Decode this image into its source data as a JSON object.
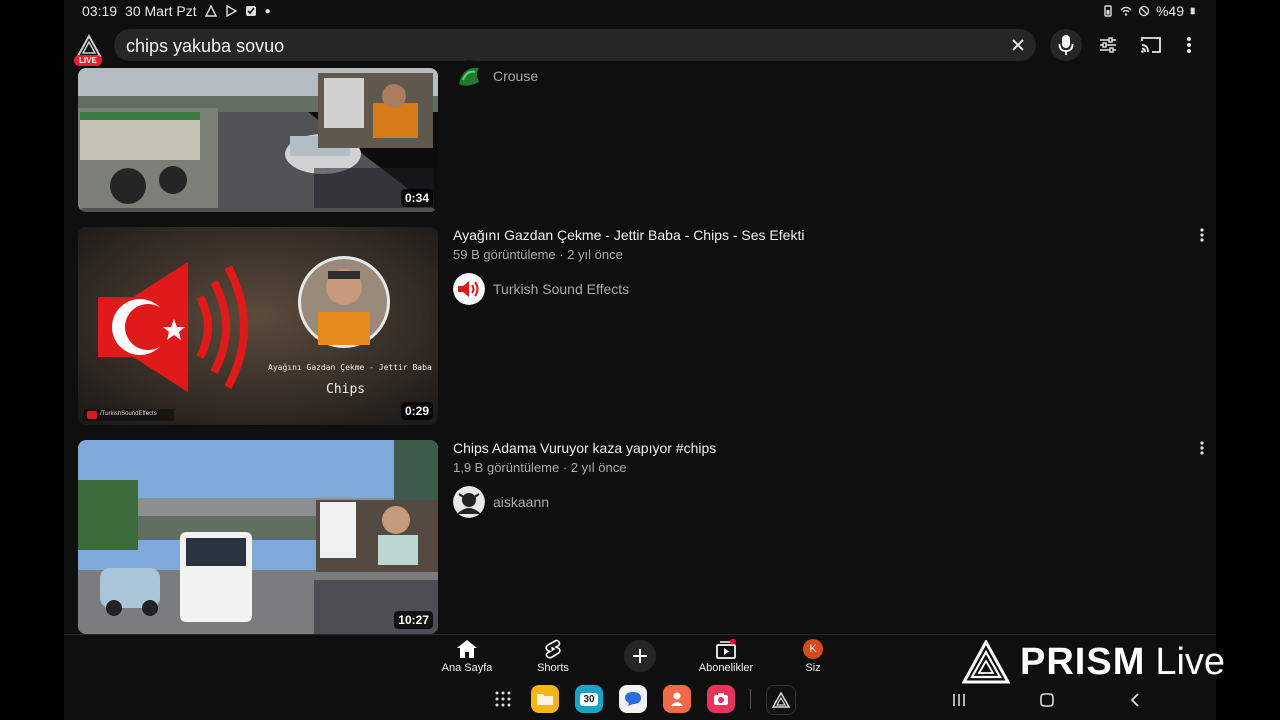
{
  "status_bar": {
    "time": "03:19",
    "date": "30 Mart Pzt",
    "battery": "%49"
  },
  "search": {
    "query": "chips yakuba sovuo",
    "live_badge": "LIVE"
  },
  "results": [
    {
      "duration": "0:34",
      "channel": "Crouse"
    },
    {
      "title": "Ayağını Gazdan Çekme - Jettir Baba - Chips - Ses Efekti",
      "meta": "59 B görüntüleme · 2 yıl önce",
      "channel": "Turkish Sound Effects",
      "duration": "0:29",
      "thumb_caption": "Ayağını Gazdan Çekme - Jettir Baba",
      "thumb_subcaption": "Chips",
      "thumb_watermark": "/TurkishSoundEffects"
    },
    {
      "title": "Chips Adama Vuruyor kaza yapıyor #chips",
      "meta": "1,9 B görüntüleme · 2 yıl önce",
      "channel": "aiskaann",
      "duration": "10:27"
    }
  ],
  "bottom_nav": {
    "home": "Ana Sayfa",
    "shorts": "Shorts",
    "subscriptions": "Abonelikler",
    "you": "Siz",
    "you_initial": "K"
  },
  "dock": {
    "calendar_day": "30"
  },
  "overlay": {
    "brand": "PRISM",
    "brand_suffix": "Live"
  },
  "colors": {
    "background": "#0f0f0f",
    "live_red": "#e3222d",
    "avatar_orange": "#d84a1b"
  }
}
